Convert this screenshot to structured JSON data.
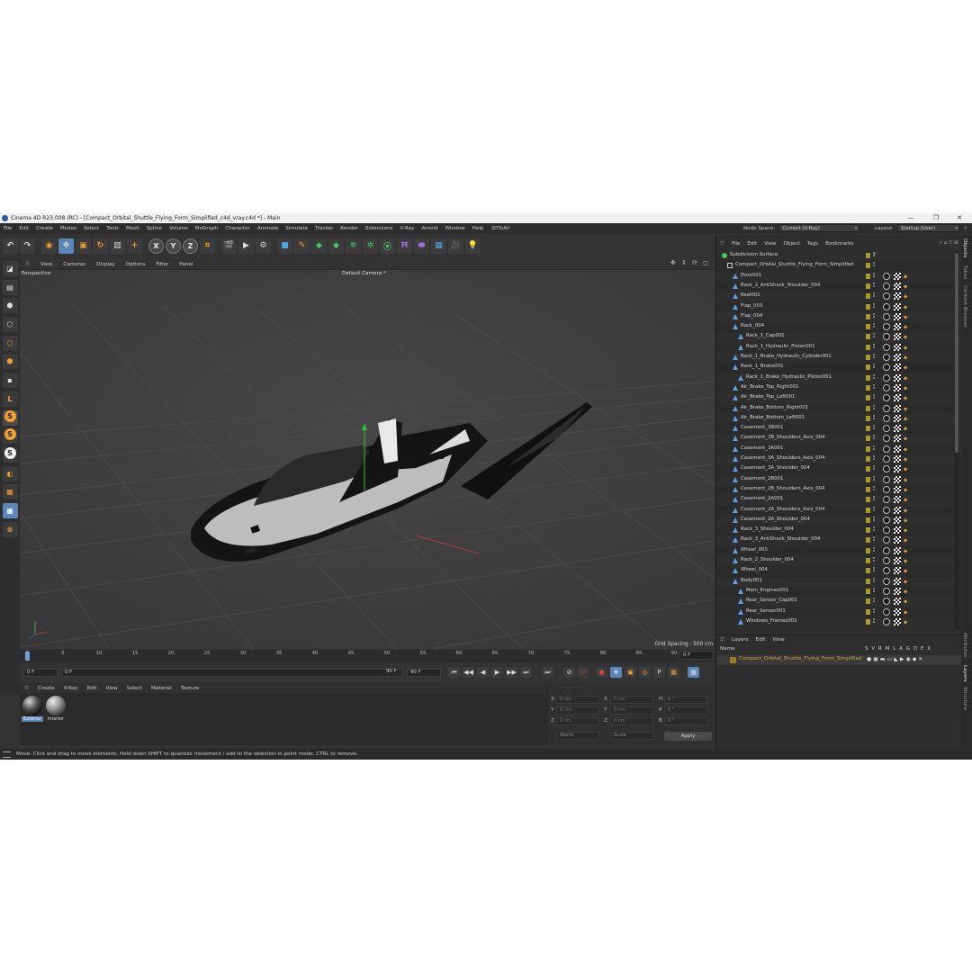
{
  "window": {
    "title": "Cinema 4D R23.008 (RC) - [Compact_Orbital_Shuttle_Flying_Form_Simplified_c4d_vray.c4d *] - Main",
    "controls": [
      "—",
      "❐",
      "✕"
    ]
  },
  "menubar": {
    "items": [
      "File",
      "Edit",
      "Create",
      "Modes",
      "Select",
      "Tools",
      "Mesh",
      "Spline",
      "Volume",
      "MoGraph",
      "Character",
      "Animate",
      "Simulate",
      "Tracker",
      "Render",
      "Extensions",
      "V-Ray",
      "Arnold",
      "Window",
      "Help",
      "3DToAll"
    ],
    "node_space_label": "Node Space:",
    "node_space_value": "Current (V-Ray)",
    "layout_label": "Layout:",
    "layout_value": "Startup (User)"
  },
  "toolbar": {
    "buttons": [
      {
        "icon": "undo-icon",
        "glyph": "↶"
      },
      {
        "icon": "redo-icon",
        "glyph": "↷"
      },
      {
        "icon": "live-selection-icon",
        "glyph": "◉"
      },
      {
        "icon": "move-icon",
        "glyph": "✥"
      },
      {
        "icon": "scale-icon",
        "glyph": "▣"
      },
      {
        "icon": "rotate-icon",
        "glyph": "↻"
      },
      {
        "icon": "recent-tools-icon",
        "glyph": "▥"
      },
      {
        "icon": "add-icon",
        "glyph": "+"
      },
      {
        "icon": "x-axis-icon",
        "glyph": "X"
      },
      {
        "icon": "y-axis-icon",
        "glyph": "Y"
      },
      {
        "icon": "z-axis-icon",
        "glyph": "Z"
      },
      {
        "icon": "coordinate-system-icon",
        "glyph": "⌗"
      },
      {
        "icon": "render-view-icon",
        "glyph": "🎬"
      },
      {
        "icon": "render-to-picture-viewer-icon",
        "glyph": "▶"
      },
      {
        "icon": "render-settings-icon",
        "glyph": "⚙"
      },
      {
        "icon": "cube-icon",
        "glyph": "■"
      },
      {
        "icon": "pen-icon",
        "glyph": "✎"
      },
      {
        "icon": "subdivision-icon",
        "glyph": "◆"
      },
      {
        "icon": "array-icon",
        "glyph": "◆"
      },
      {
        "icon": "cloner-icon",
        "glyph": "✲"
      },
      {
        "icon": "field-icon",
        "glyph": "✲"
      },
      {
        "icon": "deformer-icon",
        "glyph": "⦿"
      },
      {
        "icon": "bend-icon",
        "glyph": "Ħ"
      },
      {
        "icon": "floor-icon",
        "glyph": "⬬"
      },
      {
        "icon": "environment-icon",
        "glyph": "▦"
      },
      {
        "icon": "camera-icon",
        "glyph": "🎥"
      },
      {
        "icon": "light-icon",
        "glyph": "💡"
      }
    ]
  },
  "lefttools": {
    "buttons": [
      {
        "icon": "make-editable-icon",
        "glyph": "◪"
      },
      {
        "icon": "texture-mode-icon",
        "glyph": "▤"
      },
      {
        "icon": "model-mode-icon",
        "glyph": "⬢"
      },
      {
        "icon": "points-mode-icon",
        "glyph": "⬡"
      },
      {
        "icon": "edges-mode-icon",
        "glyph": "⬡"
      },
      {
        "icon": "polygons-mode-icon",
        "glyph": "⬢"
      },
      {
        "icon": "uv-mode-icon",
        "glyph": "▪"
      },
      {
        "icon": "axis-mode-icon",
        "glyph": "L"
      },
      {
        "icon": "snap-icon",
        "glyph": "S"
      },
      {
        "icon": "snap-settings-icon",
        "glyph": "S"
      },
      {
        "icon": "quantize-icon",
        "glyph": "S"
      },
      {
        "icon": "tweak-icon",
        "glyph": "◐"
      },
      {
        "icon": "workplane-icon",
        "glyph": "▦"
      },
      {
        "icon": "locked-workplane-icon",
        "glyph": "▦"
      },
      {
        "icon": "planar-workplane-icon",
        "glyph": "⊚"
      }
    ]
  },
  "viewport": {
    "menu": [
      "View",
      "Cameras",
      "Display",
      "Options",
      "Filter",
      "Panel"
    ],
    "mode": "Perspective",
    "camera": "Default Camera *",
    "grid_spacing": "Grid Spacing : 500 cm",
    "nav_glyphs": "✥ ⇕ ⟳ ◻"
  },
  "timeline": {
    "ticks": [
      "0",
      "5",
      "10",
      "15",
      "20",
      "25",
      "30",
      "35",
      "40",
      "45",
      "50",
      "55",
      "60",
      "65",
      "70",
      "75",
      "80",
      "85",
      "90"
    ],
    "current_frame": "0 F"
  },
  "transport": {
    "start": "0 F",
    "min": "0 F",
    "max": "90 F",
    "end": "90 F",
    "buttons": [
      "⏮",
      "◀◀",
      "◀",
      "▶",
      "▶▶",
      "⏭",
      "⏭"
    ],
    "key_buttons": [
      "⊘",
      "⊙",
      "●",
      "✥",
      "▣",
      "◎",
      "P",
      "▦"
    ],
    "extra": "▦"
  },
  "materials": {
    "menu": [
      "Create",
      "V-Ray",
      "Edit",
      "View",
      "Select",
      "Material",
      "Texture"
    ],
    "items": [
      "Exterior",
      "Interior"
    ]
  },
  "coordinates": {
    "rows": [
      {
        "a": "X",
        "av": "0 cm",
        "b": "X",
        "bv": "0 cm",
        "c": "H",
        "cv": "0 °"
      },
      {
        "a": "Y",
        "av": "0 cm",
        "b": "Y",
        "bv": "0 cm",
        "c": "P",
        "cv": "0 °"
      },
      {
        "a": "Z",
        "av": "0 cm",
        "b": "Z",
        "bv": "0 cm",
        "c": "B",
        "cv": "0 °"
      }
    ],
    "mode_world": "World",
    "mode_scale": "Scale",
    "apply": "Apply",
    "header_dashes": "- -     - -     - -"
  },
  "status": {
    "text": "Move: Click and drag to move elements. Hold down SHIFT to quantize movement / add to the selection in point mode, CTRL to remove."
  },
  "objects": {
    "menu": [
      "File",
      "Edit",
      "View",
      "Object",
      "Tags",
      "Bookmarks"
    ],
    "tree": [
      {
        "name": "Subdivision Surface",
        "depth": 0,
        "kind": "subdiv"
      },
      {
        "name": "Compact_Orbital_Shuttle_Flying_Form_Simplified",
        "depth": 1,
        "kind": "null"
      },
      {
        "name": "Door001",
        "depth": 2,
        "kind": "poly"
      },
      {
        "name": "Rack_2_AntiShock_Shoulder_004",
        "depth": 2,
        "kind": "poly"
      },
      {
        "name": "Keel001",
        "depth": 2,
        "kind": "poly"
      },
      {
        "name": "Flap_003",
        "depth": 2,
        "kind": "poly"
      },
      {
        "name": "Flap_004",
        "depth": 2,
        "kind": "poly"
      },
      {
        "name": "Rack_004",
        "depth": 2,
        "kind": "poly"
      },
      {
        "name": "Rack_1_Cap001",
        "depth": 3,
        "kind": "poly"
      },
      {
        "name": "Rack_1_Hydraulic_Piston001",
        "depth": 3,
        "kind": "poly"
      },
      {
        "name": "Rack_1_Brake_Hydraulic_Cylinder001",
        "depth": 2,
        "kind": "poly"
      },
      {
        "name": "Rack_1_Brake001",
        "depth": 2,
        "kind": "poly"
      },
      {
        "name": "Rack_1_Brake_Hydraulic_Piston001",
        "depth": 3,
        "kind": "poly"
      },
      {
        "name": "Air_Brake_Top_Right001",
        "depth": 2,
        "kind": "poly"
      },
      {
        "name": "Air_Brake_Top_Left001",
        "depth": 2,
        "kind": "poly"
      },
      {
        "name": "Air_Brake_Bottom_Right001",
        "depth": 2,
        "kind": "poly"
      },
      {
        "name": "Air_Brake_Bottom_Left001",
        "depth": 2,
        "kind": "poly"
      },
      {
        "name": "Casement_3B001",
        "depth": 2,
        "kind": "poly"
      },
      {
        "name": "Casement_3B_Shoulders_Axis_004",
        "depth": 2,
        "kind": "poly"
      },
      {
        "name": "Casement_3A001",
        "depth": 2,
        "kind": "poly"
      },
      {
        "name": "Casement_3A_Shoulders_Axis_004",
        "depth": 2,
        "kind": "poly"
      },
      {
        "name": "Casement_3A_Shoulder_004",
        "depth": 2,
        "kind": "poly"
      },
      {
        "name": "Casement_2B001",
        "depth": 2,
        "kind": "poly"
      },
      {
        "name": "Casement_2B_Shoulders_Axis_004",
        "depth": 2,
        "kind": "poly"
      },
      {
        "name": "Casement_2A001",
        "depth": 2,
        "kind": "poly"
      },
      {
        "name": "Casement_2A_Shoulders_Axis_004",
        "depth": 2,
        "kind": "poly"
      },
      {
        "name": "Casement_2A_Shoulder_004",
        "depth": 2,
        "kind": "poly"
      },
      {
        "name": "Rack_3_Shoulder_004",
        "depth": 2,
        "kind": "poly"
      },
      {
        "name": "Rack_3_AntiShock_Shoulder_004",
        "depth": 2,
        "kind": "poly"
      },
      {
        "name": "Wheel_003",
        "depth": 2,
        "kind": "poly"
      },
      {
        "name": "Rack_2_Shoulder_004",
        "depth": 2,
        "kind": "poly"
      },
      {
        "name": "Wheel_004",
        "depth": 2,
        "kind": "poly"
      },
      {
        "name": "Body001",
        "depth": 2,
        "kind": "poly"
      },
      {
        "name": "Main_Engines001",
        "depth": 3,
        "kind": "poly"
      },
      {
        "name": "Rear_Sensor_Cap001",
        "depth": 3,
        "kind": "poly"
      },
      {
        "name": "Rear_Sensor001",
        "depth": 3,
        "kind": "poly"
      },
      {
        "name": "Windows_Frames001",
        "depth": 3,
        "kind": "poly"
      }
    ]
  },
  "layers": {
    "menu": [
      "Layers",
      "Edit",
      "View"
    ],
    "name_header": "Name",
    "flags_header": "S V R M L A G D E X",
    "rows": [
      {
        "name": "Compact_Orbital_Shuttle_Flying_Form_Simplified"
      }
    ]
  },
  "sidetabs": [
    "Objects",
    "Takes",
    "Content Browser",
    "Attributes",
    "Layers",
    "Structure"
  ],
  "colors": {
    "accent": "#5b87b8",
    "orange": "#f0a030",
    "layer": "#d8a040"
  }
}
